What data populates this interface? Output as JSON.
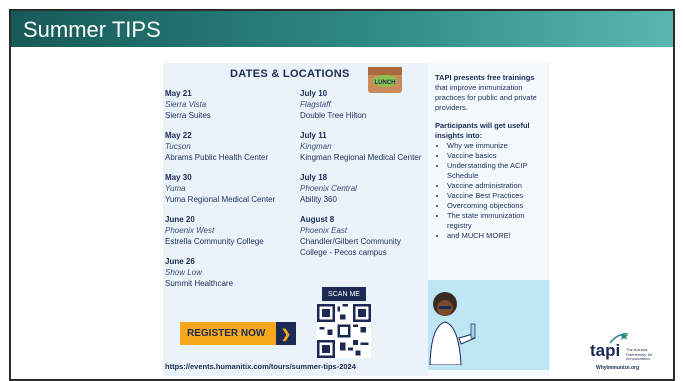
{
  "slide": {
    "title": "Summer TIPS"
  },
  "flyer": {
    "header": "DATES & LOCATIONS",
    "lunch_label": "LUNCH",
    "left_column": [
      {
        "date": "May 21",
        "city": "Sierra Vista",
        "venue": "Sierra Suites"
      },
      {
        "date": "May 22",
        "city": "Tucson",
        "venue": "Abrams Public Health Center"
      },
      {
        "date": "May 30",
        "city": "Yuma",
        "venue": "Yuma Regional Medical Center"
      },
      {
        "date": "June 20",
        "city": "Phoenix West",
        "venue": "Estrella Community College"
      },
      {
        "date": "June 26",
        "city": "Show Low",
        "venue": "Summit Healthcare"
      }
    ],
    "right_column": [
      {
        "date": "July 10",
        "city": "Flagstaff",
        "venue": "Double Tree Hilton"
      },
      {
        "date": "July 11",
        "city": "Kingman",
        "venue": "Kingman Regional Medical Center"
      },
      {
        "date": "July 18",
        "city": "Phoenix Central",
        "venue": "Ability 360"
      },
      {
        "date": "August 8",
        "city": "Phoenix East",
        "venue": "Chandler/Gilbert Community College - Pecos campus"
      }
    ],
    "intro_bold": "TAPI presents free trainings",
    "intro_rest": " that improve immunization practices for public and private providers.",
    "participants_heading": "Participants will get useful insights into:",
    "topics": [
      "Why we immunize",
      "Vaccine basics",
      "Understanding the ACIP Schedule",
      "Vaccine administration",
      "Vaccine Best Practices",
      "Overcoming objections",
      "The state immunization registry",
      "and MUCH MORE!"
    ],
    "register_label": "REGISTER NOW",
    "register_arrow": "❯",
    "scan_label": "SCAN ME",
    "url": "https://events.humanitix.com/tours/summer-tips-2024"
  },
  "logo": {
    "name": "tapi",
    "tagline": "The Arizona Partnership for Immunization",
    "site": "WhyImmunize.org"
  },
  "colors": {
    "title_bar": "#2f8a86",
    "navy": "#1b2a55",
    "orange": "#f7a81b"
  }
}
